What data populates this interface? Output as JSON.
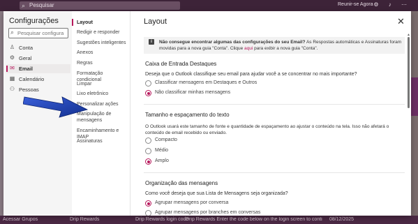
{
  "app": {
    "search_placeholder": "Pesquisar",
    "meet_label": "Reunir-se Agora"
  },
  "background": {
    "bottom_left": "Acessar Grupos",
    "bottom_sender": "Drip Rewards",
    "bottom_subject": "Drip Rewards login code",
    "bottom_preview": "Drip Rewards Enter the code below on the login screen to continue: 880765 This...",
    "bottom_date": "08/12/2025"
  },
  "settings": {
    "title": "Configurações",
    "search_placeholder": "Pesquisar configura",
    "categories": [
      {
        "label": "Conta",
        "icon": "person-icon"
      },
      {
        "label": "Geral",
        "icon": "gear-icon"
      },
      {
        "label": "Email",
        "icon": "mail-icon",
        "selected": true
      },
      {
        "label": "Calendário",
        "icon": "calendar-icon"
      },
      {
        "label": "Pessoas",
        "icon": "people-icon"
      }
    ],
    "subcategories": [
      {
        "label": "Layout",
        "selected": true
      },
      {
        "label": "Redigir e responder"
      },
      {
        "label": "Sugestões inteligentes"
      },
      {
        "label": "Anexos"
      },
      {
        "label": "Regras"
      },
      {
        "label": "Formatação condicional"
      },
      {
        "label": "Limpar"
      },
      {
        "label": "Lixo eletrônico"
      },
      {
        "label": "Personalizar ações"
      },
      {
        "label": "Manipulação de mensagens"
      },
      {
        "label": "Encaminhamento e IMAP"
      },
      {
        "label": "Assinaturas"
      }
    ]
  },
  "layout_pane": {
    "title": "Layout",
    "info_bold": "Não consegue encontrar algumas das configurações do seu Email?",
    "info_text_1": " As Respostas automáticas e Assinaturas foram movidas para a nova guia \"Conta\". Clique ",
    "info_link": "aqui",
    "info_text_2": " para exibir a nova guia \"Conta\".",
    "focused_inbox": {
      "heading": "Caixa de Entrada Destaques",
      "question": "Deseja que o Outlook classifique seu email para ajudar você a se concentrar no mais importante?",
      "options": [
        "Classificar mensagens em Destaques e Outros",
        "Não classificar minhas mensagens"
      ],
      "selected_index": 1
    },
    "text_size": {
      "heading": "Tamanho e espaçamento do texto",
      "description": "O Outlook usará este tamanho de fonte e quantidade de espaçamento ao ajustar o conteúdo na tela. Isso não afetará o conteúdo de email recebido ou enviado.",
      "options": [
        "Compacto",
        "Médio",
        "Amplo"
      ],
      "selected_index": 2
    },
    "organization": {
      "heading": "Organização das mensagens",
      "question": "Como você deseja que sua Lista de Mensagens seja organizada?",
      "options": [
        "Agrupar mensagens por conversa",
        "Agrupar mensagens por branches em conversas"
      ],
      "selected_index": 0
    }
  },
  "colors": {
    "accent": "#b7195c",
    "topbar": "#3d2338",
    "arrow": "#1f3fa8"
  }
}
